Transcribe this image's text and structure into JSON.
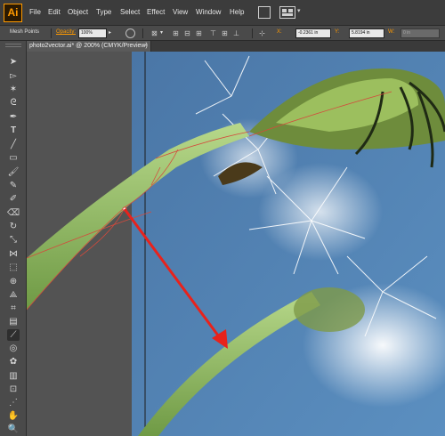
{
  "app": {
    "logo_text": "Ai",
    "brand_color": "#ff9a00"
  },
  "menubar": {
    "items": [
      "File",
      "Edit",
      "Object",
      "Type",
      "Select",
      "Effect",
      "View",
      "Window",
      "Help"
    ]
  },
  "control_bar": {
    "selection_label": "Mesh Points",
    "opacity_label": "Opacity:",
    "opacity_value": "100%",
    "x_label": "X:",
    "x_value": "-0.2361 in",
    "y_label": "Y:",
    "y_value": "5.8194 in",
    "w_label": "W:",
    "w_value": "0 in"
  },
  "document": {
    "tab_title": "photo2vector.ai* @ 200% (CMYK/Preview)",
    "close_glyph": "×"
  },
  "toolbar": {
    "tools": [
      "selection-tool",
      "direct-selection-tool",
      "magic-wand-tool",
      "lasso-tool",
      "pen-tool",
      "type-tool",
      "line-tool",
      "rectangle-tool",
      "paintbrush-tool",
      "pencil-tool",
      "blob-brush-tool",
      "eraser-tool",
      "rotate-tool",
      "scale-tool",
      "width-tool",
      "free-transform-tool",
      "shape-builder-tool",
      "perspective-grid-tool",
      "mesh-tool",
      "gradient-tool",
      "eyedropper-tool",
      "blend-tool",
      "symbol-sprayer-tool",
      "column-graph-tool",
      "artboard-tool",
      "slice-tool",
      "hand-tool",
      "zoom-tool"
    ]
  },
  "colors": {
    "sky": "#4f7fb2",
    "stem": "#8fb85e",
    "arrow": "#e8221c",
    "mesh_line": "#d44a3c"
  }
}
